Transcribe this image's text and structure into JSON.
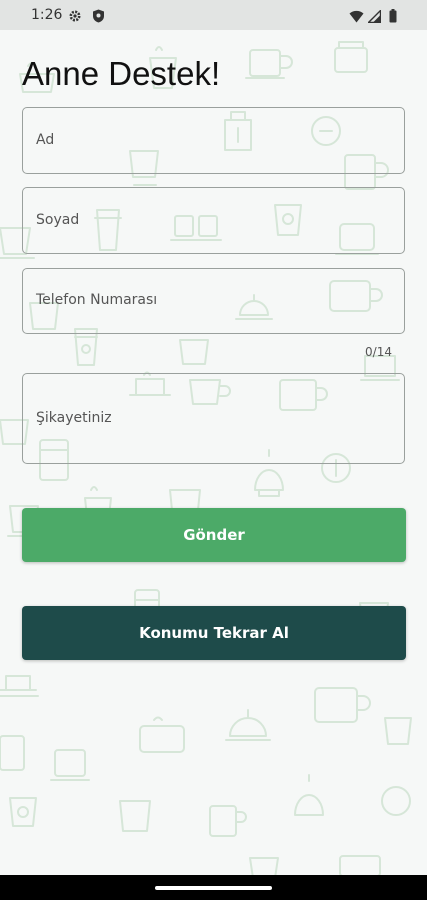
{
  "status_bar": {
    "time": "1:26",
    "icons": [
      "gear-icon",
      "shield-icon",
      "wifi-icon",
      "signal-icon",
      "battery-icon"
    ]
  },
  "page": {
    "title": "Anne Destek!"
  },
  "form": {
    "name_placeholder": "Ad",
    "surname_placeholder": "Soyad",
    "phone_placeholder": "Telefon Numarası",
    "phone_counter": "0/14",
    "complaint_placeholder": "Şikayetiniz"
  },
  "buttons": {
    "submit_label": "Gönder",
    "relocate_label": "Konumu Tekrar Al"
  },
  "colors": {
    "submit_button": "#4caa68",
    "relocate_button": "#1e4b4a",
    "background": "#f6f8f7",
    "doodle": "#d6e6d8"
  }
}
